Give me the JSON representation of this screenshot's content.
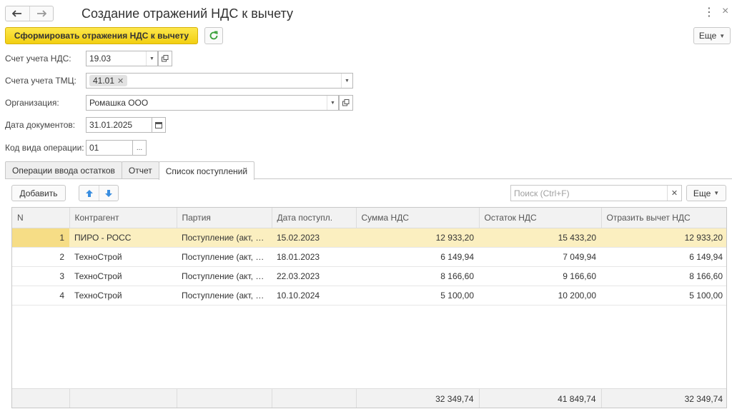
{
  "header": {
    "title": "Создание отражений НДС к вычету",
    "kebab": "⋮",
    "close": "×"
  },
  "toolbar": {
    "primary_label": "Сформировать отражения НДС к вычету",
    "more_label": "Еще"
  },
  "form": {
    "vat_account": {
      "label": "Счет учета НДС:",
      "value": "19.03"
    },
    "goods_accounts": {
      "label": "Счета учета ТМЦ:",
      "tag": "41.01"
    },
    "organization": {
      "label": "Организация:",
      "value": "Ромашка ООО"
    },
    "doc_date": {
      "label": "Дата документов:",
      "value": "31.01.2025"
    },
    "op_code": {
      "label": "Код вида операции:",
      "value": "01",
      "pick": "..."
    }
  },
  "tabs": [
    {
      "label": "Операции ввода остатков",
      "active": false
    },
    {
      "label": "Отчет",
      "active": false
    },
    {
      "label": "Список поступлений",
      "active": true
    }
  ],
  "table_toolbar": {
    "add_label": "Добавить",
    "search_placeholder": "Поиск (Ctrl+F)",
    "more_label": "Еще"
  },
  "table": {
    "columns": [
      "N",
      "Контрагент",
      "Партия",
      "Дата поступл.",
      "Сумма НДС",
      "Остаток НДС",
      "Отразить вычет НДС"
    ],
    "rows": [
      [
        "1",
        "ПИРО - РОСС",
        "Поступление (акт, накладная, УПД)",
        "15.02.2023",
        "12 933,20",
        "15 433,20",
        "12 933,20"
      ],
      [
        "2",
        "ТехноСтрой",
        "Поступление (акт, накладная, УПД)",
        "18.01.2023",
        "6 149,94",
        "7 049,94",
        "6 149,94"
      ],
      [
        "3",
        "ТехноСтрой",
        "Поступление (акт, накладная, УПД)",
        "22.03.2023",
        "8 166,60",
        "9 166,60",
        "8 166,60"
      ],
      [
        "4",
        "ТехноСтрой",
        "Поступление (акт, накладная, УПД)",
        "10.10.2024",
        "5 100,00",
        "10 200,00",
        "5 100,00"
      ]
    ],
    "totals": [
      "",
      "",
      "",
      "",
      "32 349,74",
      "41 849,74",
      "32 349,74"
    ]
  },
  "colors": {
    "primary_button": "#f6d626",
    "selected_row": "#fbefc0",
    "current_cell": "#f6dd86",
    "accent_blue": "#3a8ee0",
    "refresh_green": "#3aa13a"
  },
  "icons": [
    "arrow-left-icon",
    "arrow-right-icon",
    "kebab-icon",
    "close-icon",
    "refresh-icon",
    "dropdown-caret-icon",
    "open-form-icon",
    "calendar-icon",
    "arrow-up-icon",
    "arrow-down-icon",
    "clear-icon"
  ]
}
